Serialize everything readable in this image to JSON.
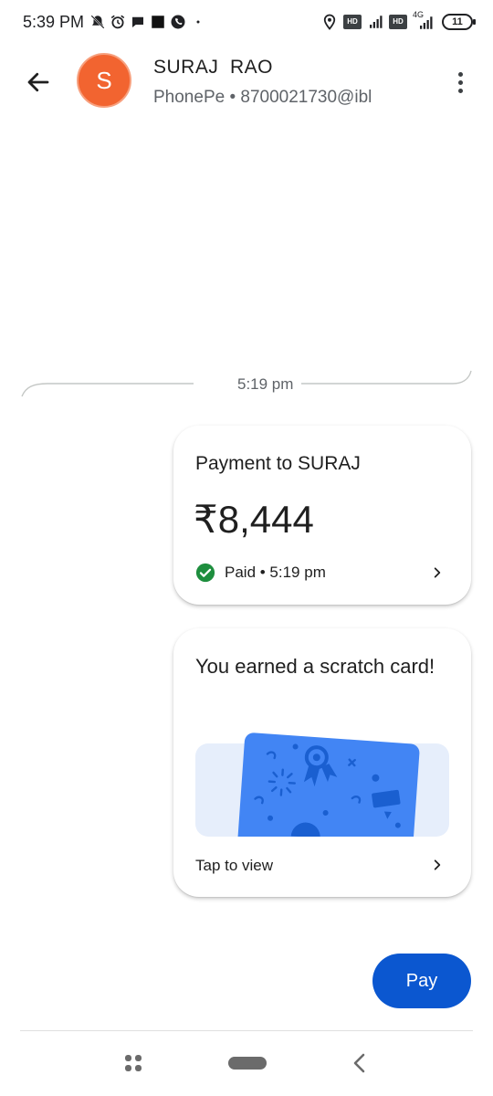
{
  "status_bar": {
    "time": "5:39 PM",
    "left_icons": [
      "mute-icon",
      "alarm-icon",
      "chat-icon",
      "square-icon",
      "phone-icon",
      "dot-icon"
    ],
    "right_icons": [
      "location-icon",
      "hd-icon",
      "signal-icon",
      "hd-icon",
      "signal-4g-icon"
    ],
    "hd_label": "HD",
    "network_label": "4G",
    "battery": "11"
  },
  "header": {
    "back_icon": "arrow-left-icon",
    "avatar_letter": "S",
    "avatar_color": "#f26430",
    "name": "SURAJ  RAO",
    "subtitle": "PhonePe • 8700021730@ibl",
    "more_icon": "more-vertical-icon"
  },
  "divider": {
    "time": "5:19 pm"
  },
  "payment_card": {
    "title": "Payment to SURAJ",
    "amount": "₹8,444",
    "status": "Paid • 5:19 pm",
    "status_color": "#1e8e3e"
  },
  "scratch_card": {
    "title": "You earned a scratch card!",
    "action": "Tap to view",
    "card_color": "#4285f4"
  },
  "pay_button": {
    "label": "Pay",
    "color": "#0b57d0"
  },
  "nav_bar": {
    "items": [
      "recents-icon",
      "home-pill",
      "back-chevron-icon"
    ]
  }
}
